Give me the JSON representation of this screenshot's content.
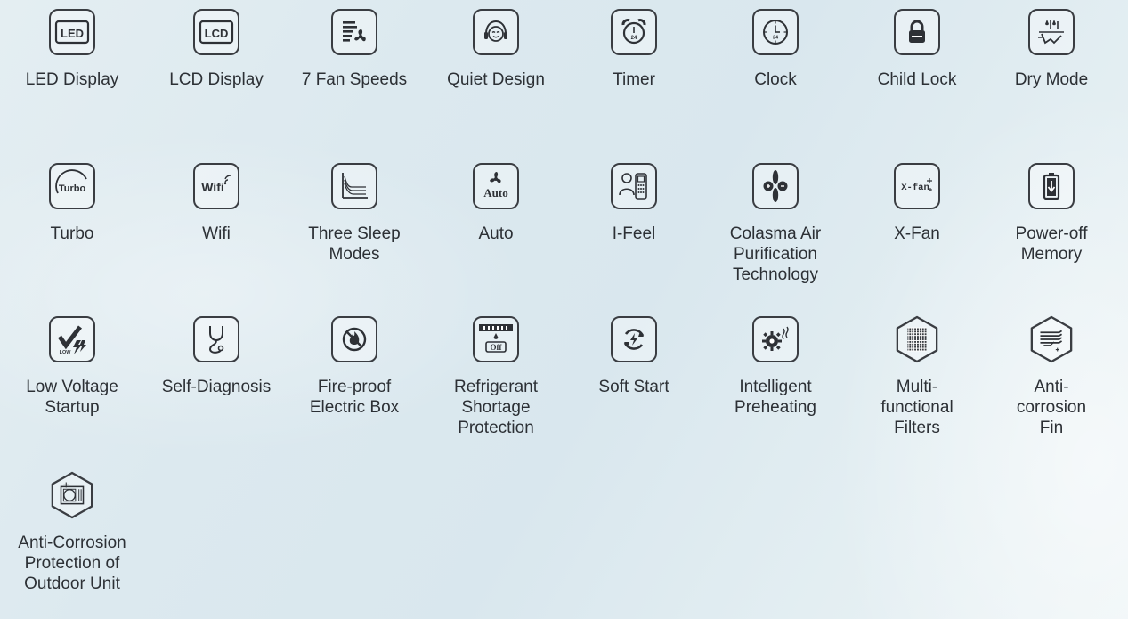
{
  "features": [
    {
      "label": "LED Display",
      "icon": "led-display-icon",
      "icon_text": "LED"
    },
    {
      "label": "LCD Display",
      "icon": "lcd-display-icon",
      "icon_text": "LCD"
    },
    {
      "label": "7 Fan Speeds",
      "icon": "fan-speeds-icon"
    },
    {
      "label": "Quiet Design",
      "icon": "quiet-design-icon"
    },
    {
      "label": "Timer",
      "icon": "alarm-clock-icon",
      "icon_text": "24"
    },
    {
      "label": "Clock",
      "icon": "clock-icon",
      "icon_text": "24"
    },
    {
      "label": "Child Lock",
      "icon": "padlock-icon"
    },
    {
      "label": "Dry Mode",
      "icon": "dry-mode-icon"
    },
    {
      "label": "Turbo",
      "icon": "turbo-icon",
      "icon_text": "Turbo"
    },
    {
      "label": "Wifi",
      "icon": "wifi-icon",
      "icon_text": "Wifi"
    },
    {
      "label": "Three Sleep\nModes",
      "icon": "sleep-modes-graph-icon"
    },
    {
      "label": "Auto",
      "icon": "auto-fan-icon",
      "icon_text": "Auto"
    },
    {
      "label": "I-Feel",
      "icon": "remote-control-icon"
    },
    {
      "label": "Colasma Air\nPurification\nTechnology",
      "icon": "air-purification-icon"
    },
    {
      "label": "X-Fan",
      "icon": "x-fan-icon",
      "icon_text": "X-fan"
    },
    {
      "label": "Power-off\nMemory",
      "icon": "battery-memory-icon"
    },
    {
      "label": "Low Voltage\nStartup",
      "icon": "low-voltage-icon",
      "icon_text": "LOW"
    },
    {
      "label": "Self-Diagnosis",
      "icon": "stethoscope-icon"
    },
    {
      "label": "Fire-proof\nElectric Box",
      "icon": "fireproof-icon"
    },
    {
      "label": "Refrigerant\nShortage\nProtection",
      "icon": "refrigerant-icon",
      "icon_text": "Off"
    },
    {
      "label": "Soft Start",
      "icon": "soft-start-icon"
    },
    {
      "label": "Intelligent\nPreheating",
      "icon": "preheating-gear-icon"
    },
    {
      "label": "Multi-\nfunctional\nFilters",
      "icon": "filter-mesh-icon"
    },
    {
      "label": "Anti-\ncorrosion\nFin",
      "icon": "anti-corrosion-fin-icon"
    },
    {
      "label": "Anti-Corrosion\nProtection of\nOutdoor Unit",
      "icon": "outdoor-unit-icon"
    }
  ]
}
